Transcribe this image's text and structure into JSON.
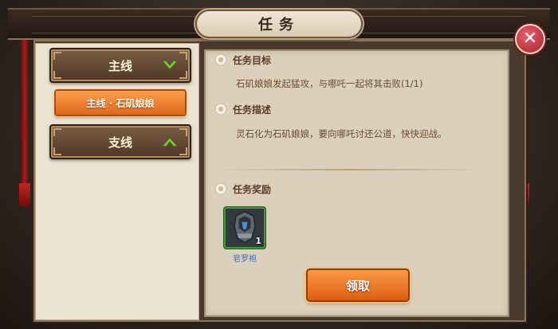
{
  "window": {
    "title": "任务"
  },
  "sidebar": {
    "main_category": {
      "label": "主线",
      "chevron": "chevron-down-icon",
      "chevron_color": "#7dc23a"
    },
    "selected_quest": {
      "label": "主线 · 石矶娘娘"
    },
    "side_category": {
      "label": "支线",
      "chevron": "chevron-up-icon",
      "chevron_color": "#7dc23a"
    }
  },
  "detail": {
    "objective": {
      "heading": "任务目标",
      "text": "石矶娘娘发起猛攻，与哪吒一起将其击败(1/1)"
    },
    "description": {
      "heading": "任务描述",
      "text": "灵石化为石矶娘娘，要向哪吒讨还公道，快快迎战。"
    },
    "rewards": {
      "heading": "任务奖励",
      "items": [
        {
          "name": "皂罗袍",
          "count": "1",
          "icon": "armor-icon"
        }
      ]
    },
    "claim_button": {
      "label": "领取"
    }
  },
  "colors": {
    "accent_orange": "#f08a34",
    "frame_brown": "#4a3a2e",
    "panel_beige": "#ebe3d0"
  }
}
